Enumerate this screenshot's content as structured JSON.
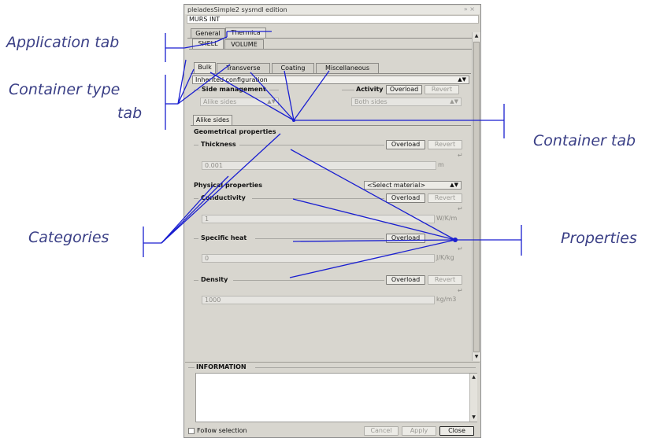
{
  "annotations": {
    "application_tab": "Application tab",
    "container_type_tab": "Container type",
    "container_type_tab2": "tab",
    "container_tab": "Container tab",
    "categories": "Categories",
    "properties": "Properties"
  },
  "window": {
    "title": "pleiadesSimple2 sysmdl edition",
    "title_controls": "» ×",
    "path": "MURS INT"
  },
  "app_tabs": [
    "General",
    "Thermica"
  ],
  "type_tabs": [
    "SHELL",
    "VOLUME"
  ],
  "container_tabs": [
    "Bulk",
    "Transverse",
    "Coating",
    "Miscellaneous"
  ],
  "config_combo": "Inherited configuration",
  "side_management": {
    "label": "Side management",
    "value": "Alike sides"
  },
  "activity": {
    "label": "Activity",
    "overload": "Overload",
    "revert": "Revert",
    "value": "Both sides"
  },
  "side_tab": "Alike sides",
  "geometrical": {
    "title": "Geometrical properties",
    "thickness": {
      "label": "Thickness",
      "overload": "Overload",
      "revert": "Revert",
      "value": "0.001",
      "unit": "m",
      "link": "↵"
    }
  },
  "physical": {
    "title": "Physical properties",
    "material": "<Select material>",
    "conductivity": {
      "label": "Conductivity",
      "overload": "Overload",
      "revert": "Revert",
      "value": "1",
      "unit": "W/K/m",
      "link": "↵"
    },
    "specific_heat": {
      "label": "Specific heat",
      "overload": "Overload",
      "value": "0",
      "unit": "J/K/kg",
      "link": "↵"
    },
    "density": {
      "label": "Density",
      "overload": "Overload",
      "revert": "Revert",
      "value": "1000",
      "unit": "kg/m3",
      "link": "↵"
    }
  },
  "information": {
    "title": "INFORMATION"
  },
  "footer": {
    "follow_selection": "Follow selection",
    "cancel": "Cancel",
    "apply": "Apply",
    "close": "Close"
  },
  "colors": {
    "annotation": "#3a3f86",
    "leader": "#1a1fd0",
    "window_bg": "#d8d6cf"
  }
}
